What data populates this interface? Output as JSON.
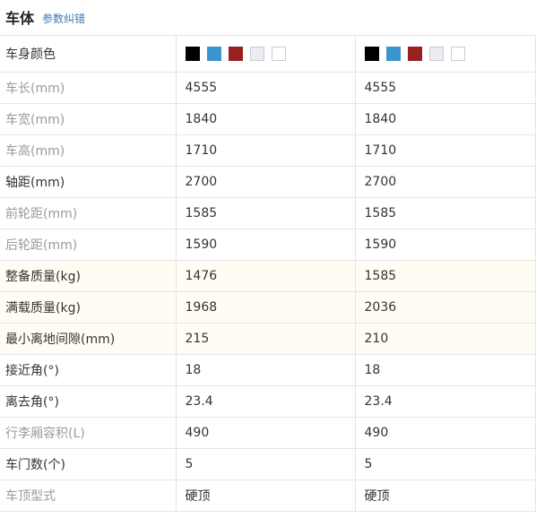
{
  "header": {
    "title": "车体",
    "link": "参数纠错"
  },
  "colors_row": {
    "label": "车身颜色",
    "col1": [
      "#000000",
      "#3a96d1",
      "#9a1f1f",
      "#ecebf2",
      "#ffffff"
    ],
    "col2": [
      "#000000",
      "#3a96d1",
      "#9a1f1f",
      "#ecebf2",
      "#ffffff"
    ]
  },
  "rows": [
    {
      "label": "车长(mm)",
      "v1": "4555",
      "v2": "4555",
      "style": "muted",
      "hl": false
    },
    {
      "label": "车宽(mm)",
      "v1": "1840",
      "v2": "1840",
      "style": "muted",
      "hl": false
    },
    {
      "label": "车高(mm)",
      "v1": "1710",
      "v2": "1710",
      "style": "muted",
      "hl": false
    },
    {
      "label": "轴距(mm)",
      "v1": "2700",
      "v2": "2700",
      "style": "dark",
      "hl": false
    },
    {
      "label": "前轮距(mm)",
      "v1": "1585",
      "v2": "1585",
      "style": "muted",
      "hl": false
    },
    {
      "label": "后轮距(mm)",
      "v1": "1590",
      "v2": "1590",
      "style": "muted",
      "hl": false
    },
    {
      "label": "整备质量(kg)",
      "v1": "1476",
      "v2": "1585",
      "style": "dark",
      "hl": true
    },
    {
      "label": "满载质量(kg)",
      "v1": "1968",
      "v2": "2036",
      "style": "dark",
      "hl": true
    },
    {
      "label": "最小离地间隙(mm)",
      "v1": "215",
      "v2": "210",
      "style": "dark",
      "hl": true
    },
    {
      "label": "接近角(°)",
      "v1": "18",
      "v2": "18",
      "style": "dark",
      "hl": false
    },
    {
      "label": "离去角(°)",
      "v1": "23.4",
      "v2": "23.4",
      "style": "dark",
      "hl": false
    },
    {
      "label": "行李厢容积(L)",
      "v1": "490",
      "v2": "490",
      "style": "muted",
      "hl": false
    },
    {
      "label": "车门数(个)",
      "v1": "5",
      "v2": "5",
      "style": "dark",
      "hl": false
    },
    {
      "label": "车顶型式",
      "v1": "硬顶",
      "v2": "硬顶",
      "style": "muted",
      "hl": false
    }
  ]
}
